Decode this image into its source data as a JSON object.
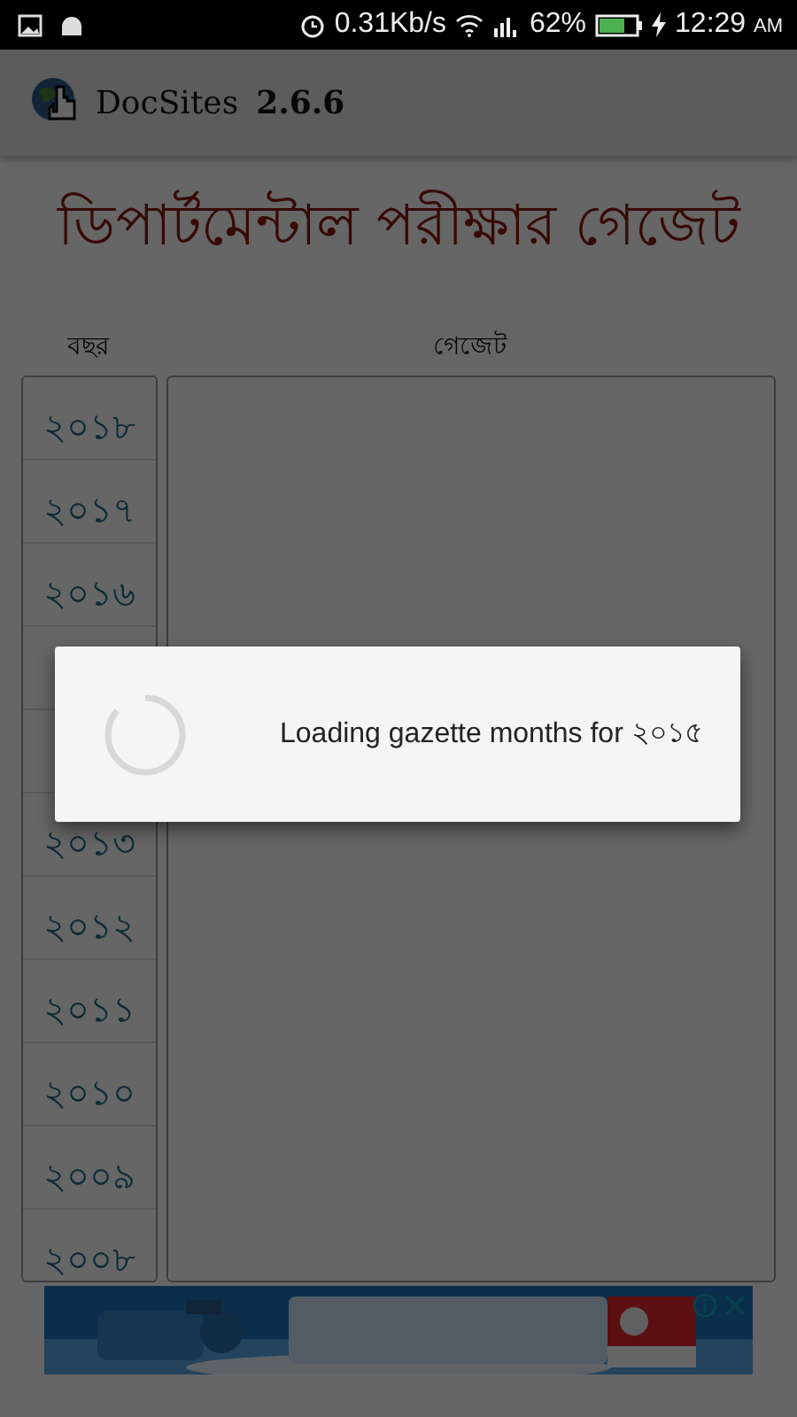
{
  "status_bar": {
    "speed": "0.31Kb/s",
    "battery": "62%",
    "time": "12:29",
    "ampm": "AM"
  },
  "app_bar": {
    "title": "DocSites",
    "version": "2.6.6"
  },
  "page": {
    "heading": "ডিপার্টমেন্টাল পরীক্ষার গেজেট",
    "year_header": "বছর",
    "gazette_header": "গেজেট",
    "years": [
      {
        "kind": "year",
        "label": "২০১৮"
      },
      {
        "kind": "year",
        "label": "২০১৭"
      },
      {
        "kind": "year",
        "label": "২০১৬"
      },
      {
        "kind": "covered"
      },
      {
        "kind": "covered"
      },
      {
        "kind": "year",
        "label": "২০১৩"
      },
      {
        "kind": "year",
        "label": "২০১২"
      },
      {
        "kind": "year",
        "label": "২০১১"
      },
      {
        "kind": "year",
        "label": "২০১০"
      },
      {
        "kind": "year",
        "label": "২০০৯"
      },
      {
        "kind": "year",
        "label": "২০০৮"
      }
    ]
  },
  "dialog": {
    "message": "Loading gazette months for ২০১৫"
  }
}
